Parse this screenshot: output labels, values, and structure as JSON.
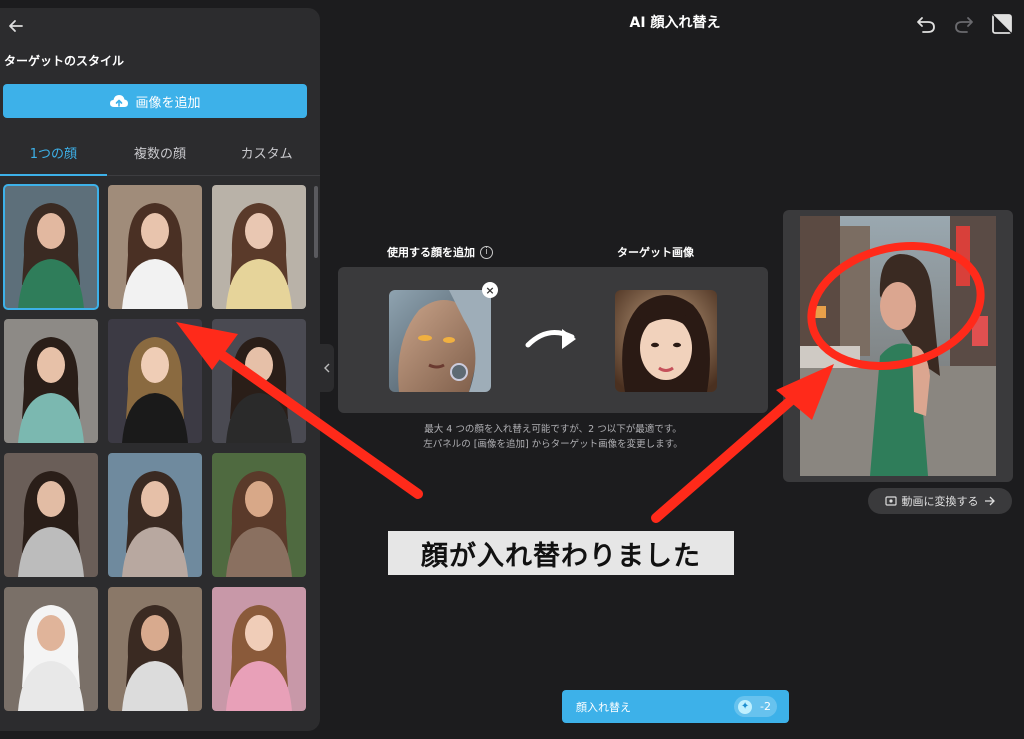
{
  "header": {
    "title": "AI 顔入れ替え",
    "icons": [
      "undo-icon",
      "redo-icon",
      "compare-icon"
    ]
  },
  "left_panel": {
    "back_icon": "arrow-left-icon",
    "section_title": "ターゲットのスタイル",
    "add_image_label": "画像を追加",
    "add_image_icon": "cloud-upload-icon",
    "tabs": [
      {
        "label": "1つの顔",
        "active": true
      },
      {
        "label": "複数の顔",
        "active": false
      },
      {
        "label": "カスタム",
        "active": false
      }
    ],
    "selected_index": 0,
    "accent": "#3db1e9"
  },
  "center": {
    "source_label": "使用する顔を追加",
    "target_label": "ターゲット画像",
    "hint_line1": "最大 4 つの顔を入れ替え可能ですが、2 つ以下が最適です。",
    "hint_line2": "左パネルの [画像を追加] からターゲット画像を変更します。"
  },
  "result": {
    "convert_label": "動画に変換する"
  },
  "bottom": {
    "swap_label": "顔入れ替え",
    "credit_cost": "-2"
  },
  "annotation": {
    "caption": "顔が入れ替わりました",
    "color": "#ff2a1a"
  }
}
